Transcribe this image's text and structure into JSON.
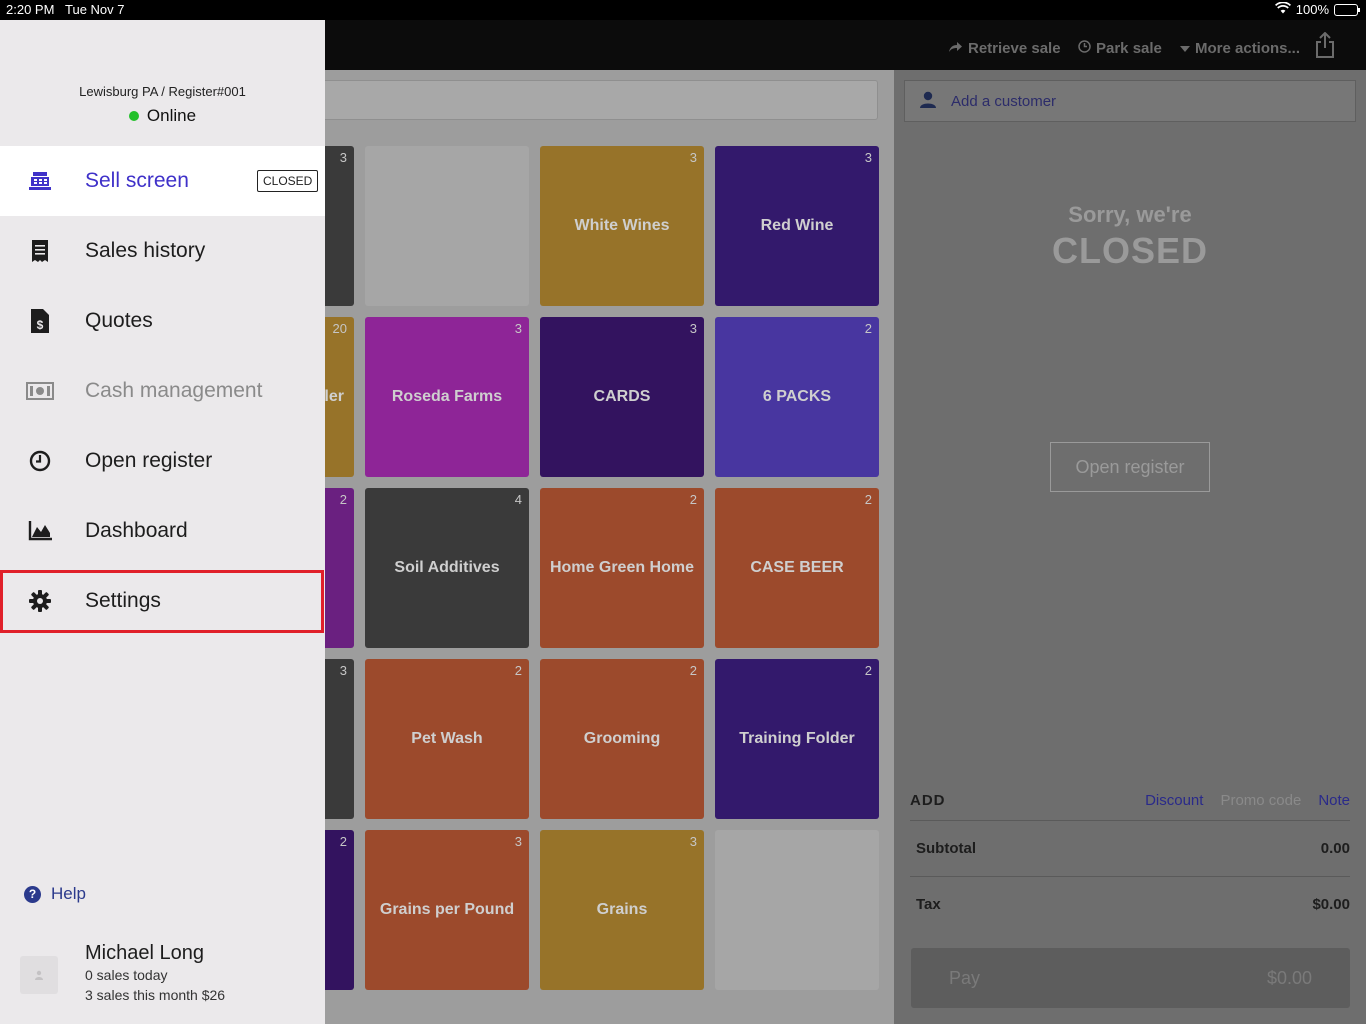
{
  "status_bar": {
    "time": "2:20 PM",
    "date": "Tue Nov 7",
    "battery": "100%"
  },
  "toolbar": {
    "retrieve_sale": "Retrieve sale",
    "park_sale": "Park sale",
    "more_actions": "More actions..."
  },
  "drawer": {
    "location": "Lewisburg PA / Register#001",
    "status": "Online",
    "closed_badge": "CLOSED",
    "items": [
      {
        "label": "Sell screen",
        "icon": "register-icon"
      },
      {
        "label": "Sales history",
        "icon": "receipt-icon"
      },
      {
        "label": "Quotes",
        "icon": "quote-document-icon"
      },
      {
        "label": "Cash management",
        "icon": "cash-icon"
      },
      {
        "label": "Open register",
        "icon": "clock-icon"
      },
      {
        "label": "Dashboard",
        "icon": "chart-icon"
      },
      {
        "label": "Settings",
        "icon": "gear-icon"
      }
    ],
    "help": "Help",
    "user": {
      "name": "Michael Long",
      "sales_today": "0 sales today",
      "sales_month": "3 sales this month $26"
    }
  },
  "tiles": [
    {
      "label": "",
      "count": "3",
      "color": "#3a3a3a"
    },
    {
      "label": "",
      "count": "",
      "color": "#a6a6a6"
    },
    {
      "label": "White Wines",
      "count": "3",
      "color": "#977329"
    },
    {
      "label": "Red Wine",
      "count": "3",
      "color": "#33196c"
    },
    {
      "label": "ler",
      "count": "20",
      "color": "#977329"
    },
    {
      "label": "Roseda Farms",
      "count": "3",
      "color": "#8e2597"
    },
    {
      "label": "CARDS",
      "count": "3",
      "color": "#33135f"
    },
    {
      "label": "6 PACKS",
      "count": "2",
      "color": "#4836a0"
    },
    {
      "label": "",
      "count": "2",
      "color": "#6a2080"
    },
    {
      "label": "Soil Additives",
      "count": "4",
      "color": "#3a3a3a"
    },
    {
      "label": "Home Green Home",
      "count": "2",
      "color": "#9c4a2c"
    },
    {
      "label": "CASE BEER",
      "count": "2",
      "color": "#9c4a2c"
    },
    {
      "label": "",
      "count": "3",
      "color": "#3a3a3a"
    },
    {
      "label": "Pet Wash",
      "count": "2",
      "color": "#9c4a2c"
    },
    {
      "label": "Grooming",
      "count": "2",
      "color": "#9c4a2c"
    },
    {
      "label": "Training Folder",
      "count": "2",
      "color": "#33196c"
    },
    {
      "label": "",
      "count": "2",
      "color": "#33135f"
    },
    {
      "label": "Grains per Pound",
      "count": "3",
      "color": "#9c4a2c"
    },
    {
      "label": "Grains",
      "count": "3",
      "color": "#977329"
    },
    {
      "label": "",
      "count": "",
      "color": "#a6a6a6"
    }
  ],
  "sale_panel": {
    "add_customer": "Add a customer",
    "sorry": "Sorry, we're",
    "closed": "CLOSED",
    "open_register": "Open register",
    "add": "ADD",
    "discount": "Discount",
    "promo_code": "Promo code",
    "note": "Note",
    "subtotal_label": "Subtotal",
    "subtotal_value": "0.00",
    "tax_label": "Tax",
    "tax_value": "$0.00",
    "pay_label": "Pay",
    "pay_value": "$0.00"
  }
}
